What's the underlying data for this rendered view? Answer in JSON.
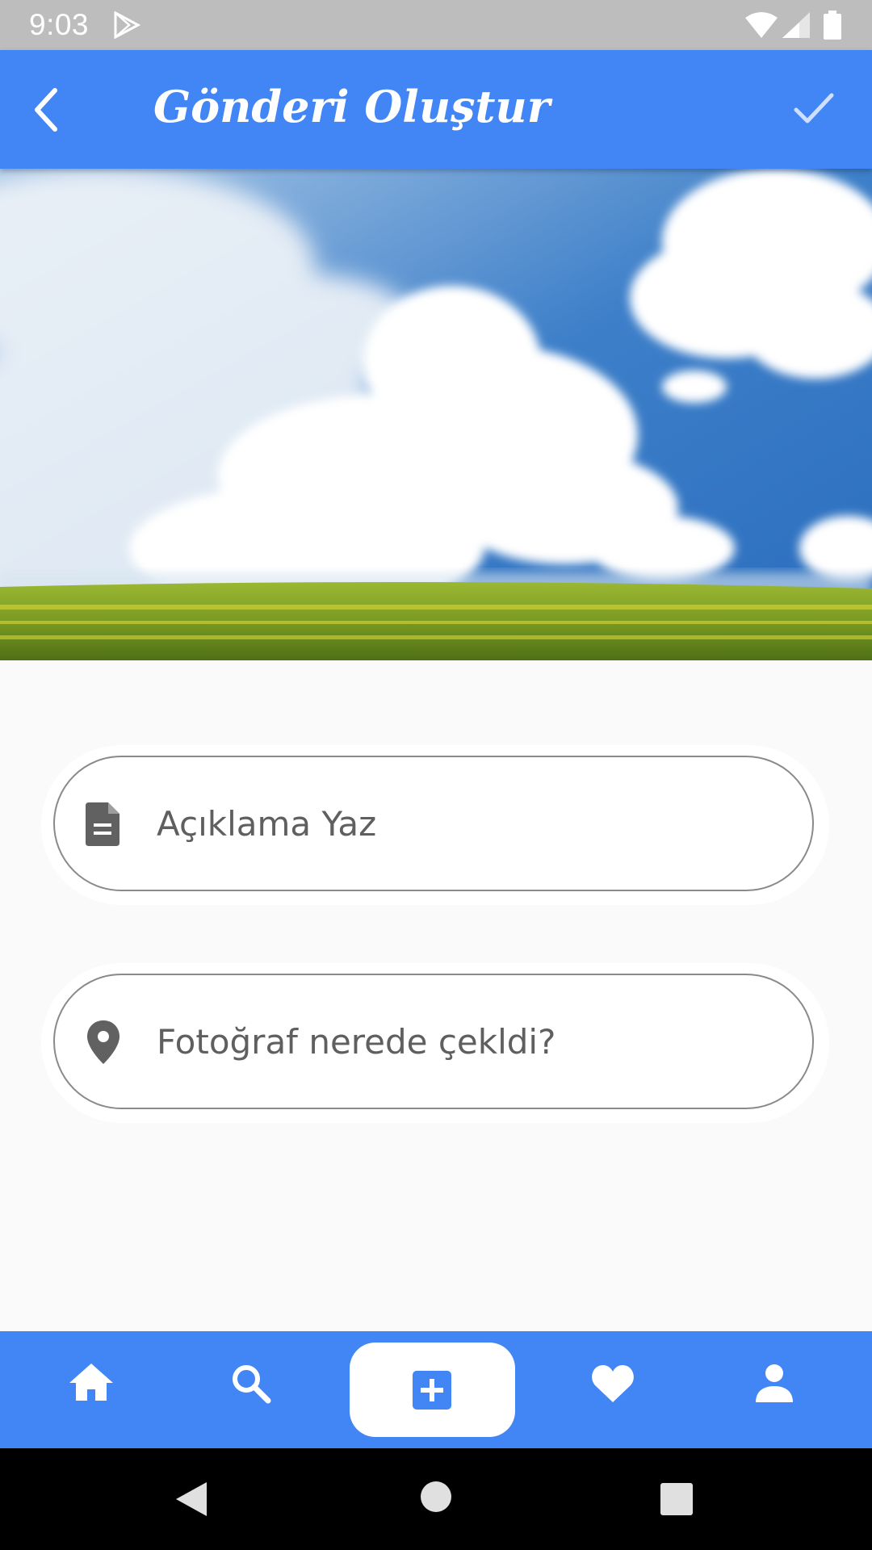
{
  "status_bar": {
    "time": "9:03",
    "icons": [
      "play-store-icon",
      "wifi-icon",
      "signal-icon",
      "battery-icon"
    ]
  },
  "app_bar": {
    "title": "Gönderi Oluştur",
    "back_icon": "back-arrow-icon",
    "confirm_icon": "check-icon",
    "color": "#4285f4"
  },
  "hero_image": {
    "description_icon": "sky-landscape-photo"
  },
  "form": {
    "description": {
      "placeholder": "Açıklama Yaz",
      "icon": "document-icon"
    },
    "location": {
      "placeholder": "Fotoğraf nerede çekldi?",
      "icon": "location-pin-icon"
    }
  },
  "bottom_nav": {
    "items": [
      {
        "icon": "home-icon"
      },
      {
        "icon": "search-icon"
      },
      {
        "icon": "add-post-icon",
        "selected": true
      },
      {
        "icon": "heart-icon"
      },
      {
        "icon": "profile-icon"
      }
    ]
  },
  "system_nav": {
    "items": [
      "back-triangle-icon",
      "home-circle-icon",
      "recents-square-icon"
    ]
  }
}
